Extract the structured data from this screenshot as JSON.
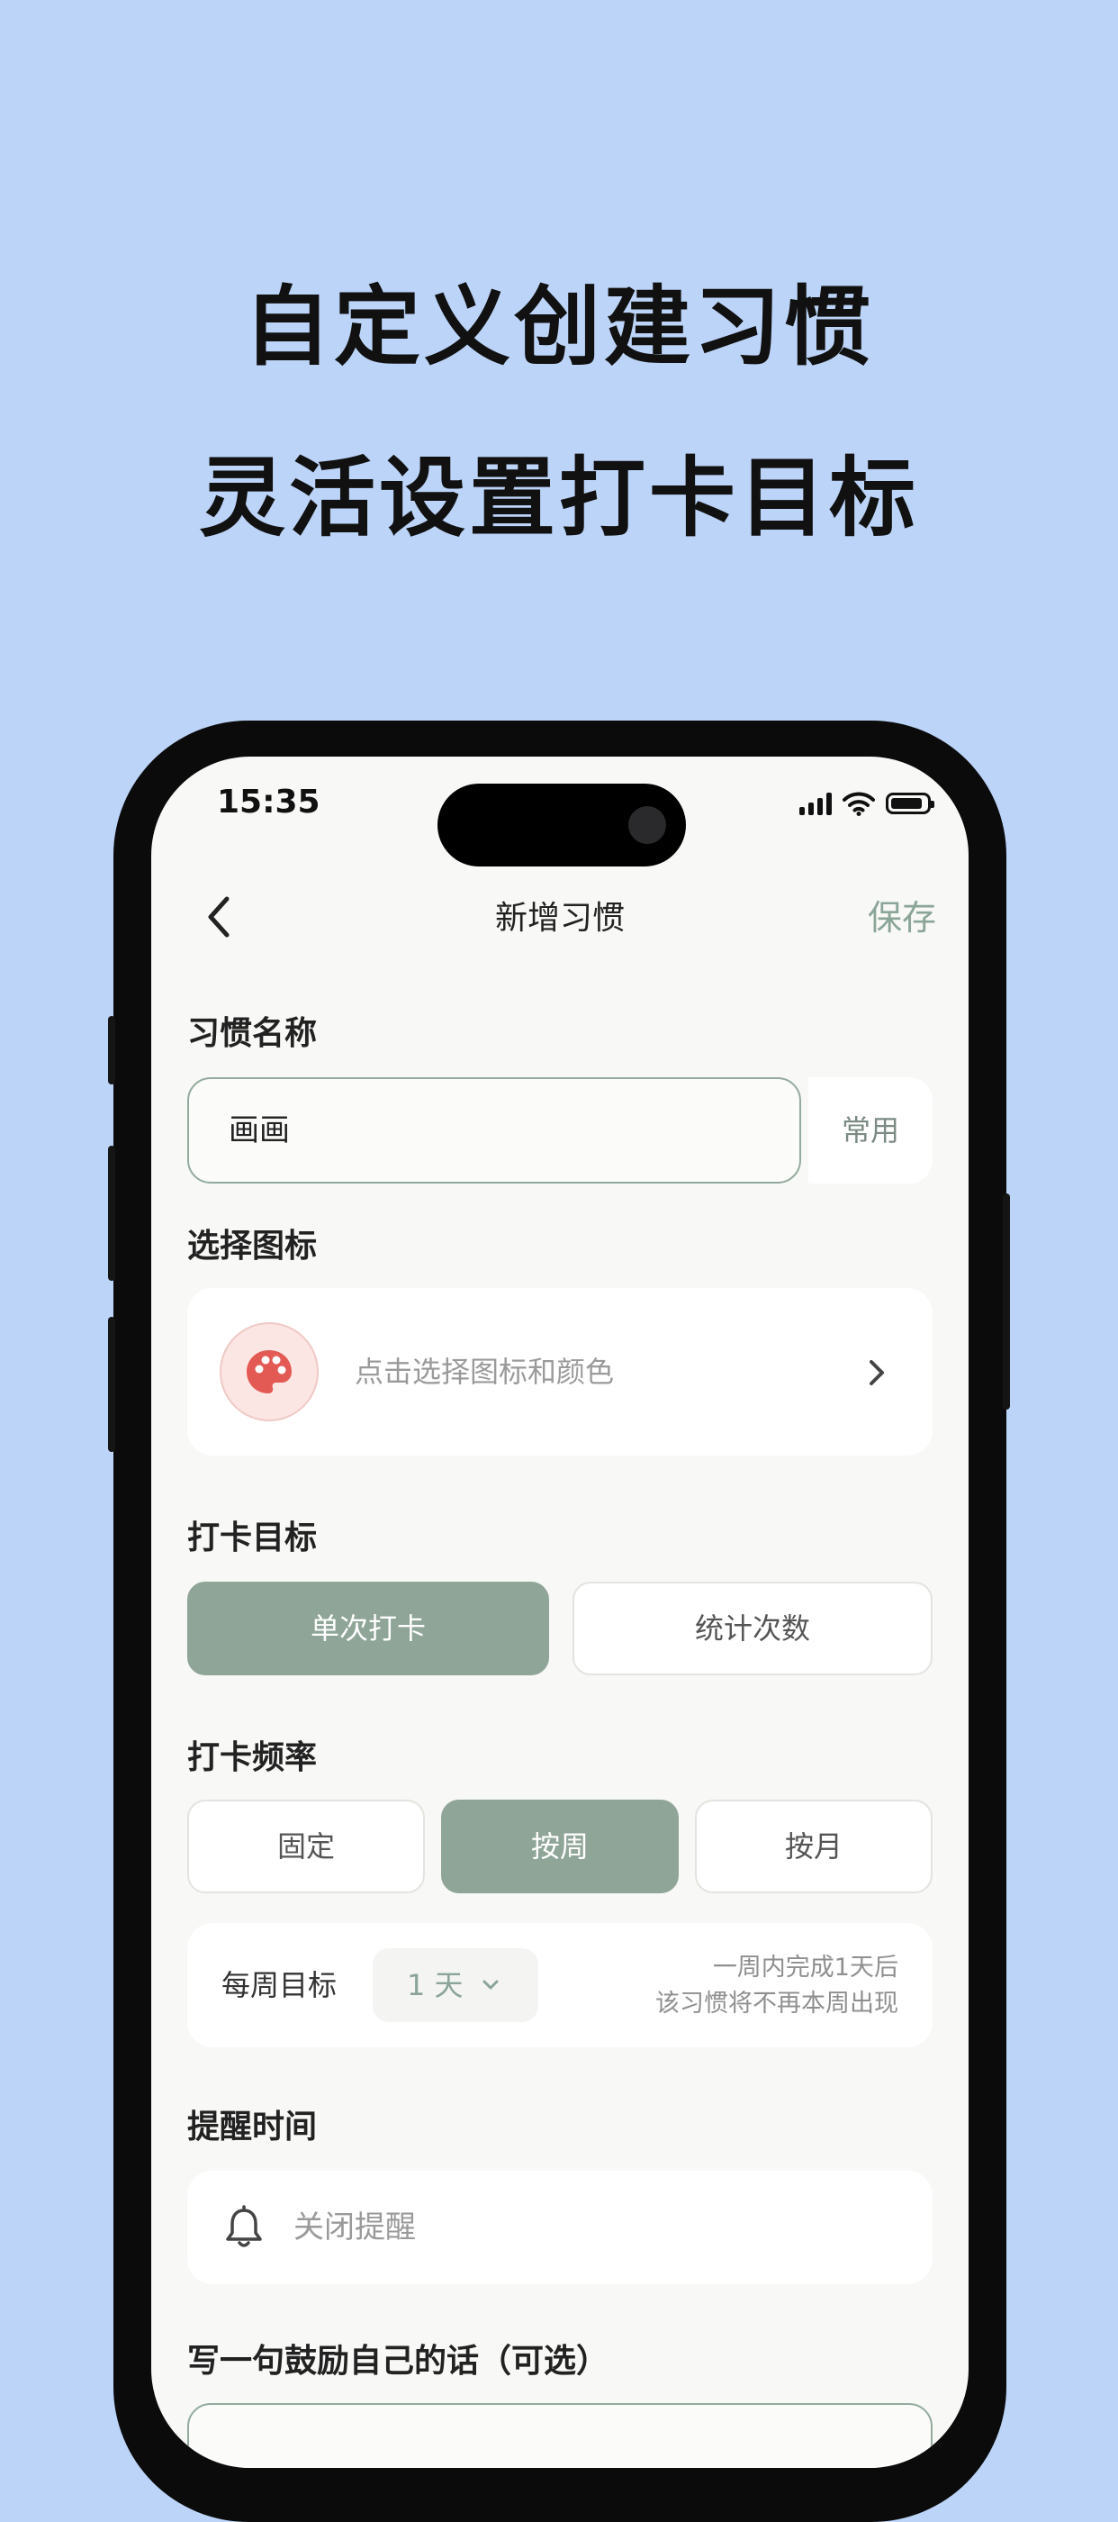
{
  "promo": {
    "line1": "自定义创建习惯",
    "line2": "灵活设置打卡目标"
  },
  "status_bar": {
    "time": "15:35",
    "icons": [
      "cellular-signal-icon",
      "wifi-icon",
      "battery-icon"
    ]
  },
  "nav": {
    "back_icon": "chevron-left-icon",
    "title": "新增习惯",
    "save_label": "保存"
  },
  "colors": {
    "background": "#bcd4f8",
    "accent": "#8fa598",
    "accent_text": "#8aa597",
    "palette_icon": "#e35a55"
  },
  "habit_name": {
    "label": "习惯名称",
    "value": "画画",
    "common_label": "常用"
  },
  "icon_picker": {
    "label": "选择图标",
    "icon": "palette-icon",
    "hint": "点击选择图标和颜色"
  },
  "checkin_goal": {
    "label": "打卡目标",
    "options": [
      {
        "label": "单次打卡",
        "selected": true
      },
      {
        "label": "统计次数",
        "selected": false
      }
    ]
  },
  "checkin_frequency": {
    "label": "打卡频率",
    "options": [
      {
        "label": "固定",
        "selected": false
      },
      {
        "label": "按周",
        "selected": true
      },
      {
        "label": "按月",
        "selected": false
      }
    ],
    "weekly_goal": {
      "label": "每周目标",
      "value": "1 天",
      "note_line1": "一周内完成1天后",
      "note_line2": "该习惯将不再本周出现"
    }
  },
  "reminder": {
    "label": "提醒时间",
    "value": "关闭提醒"
  },
  "motto": {
    "label": "写一句鼓励自己的话（可选）",
    "value": ""
  }
}
